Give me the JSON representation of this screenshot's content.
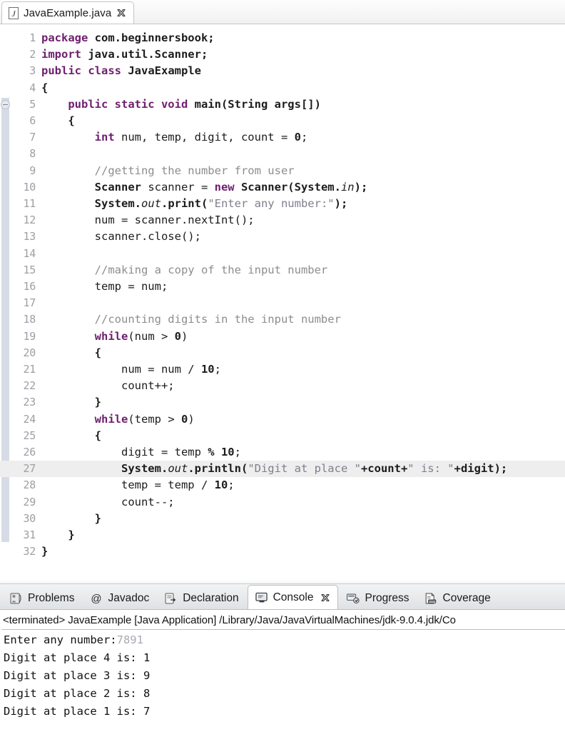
{
  "editor": {
    "tab": {
      "filename": "JavaExample.java",
      "file_icon": "java-file-icon",
      "close_icon": "close-icon"
    },
    "current_line": 27,
    "fold_marker_line": 5,
    "lines": [
      {
        "n": "1",
        "segments": [
          {
            "t": "package ",
            "c": "kw"
          },
          {
            "t": "com.beginnersbook;",
            "c": "bld"
          }
        ]
      },
      {
        "n": "2",
        "segments": [
          {
            "t": "import ",
            "c": "kw"
          },
          {
            "t": "java.util.Scanner;",
            "c": "bld"
          }
        ]
      },
      {
        "n": "3",
        "segments": [
          {
            "t": "public class ",
            "c": "kw"
          },
          {
            "t": "JavaExample",
            "c": "bld"
          }
        ]
      },
      {
        "n": "4",
        "segments": [
          {
            "t": "{",
            "c": "bld"
          }
        ]
      },
      {
        "n": "5",
        "segments": [
          {
            "t": "    ",
            "c": ""
          },
          {
            "t": "public static void ",
            "c": "kw"
          },
          {
            "t": "main(String args[])",
            "c": "bld"
          }
        ]
      },
      {
        "n": "6",
        "segments": [
          {
            "t": "    {",
            "c": "bld"
          }
        ]
      },
      {
        "n": "7",
        "segments": [
          {
            "t": "        ",
            "c": ""
          },
          {
            "t": "int ",
            "c": "kw"
          },
          {
            "t": "num, temp, digit, count = ",
            "c": ""
          },
          {
            "t": "0",
            "c": "num"
          },
          {
            "t": ";",
            "c": ""
          }
        ]
      },
      {
        "n": "8",
        "segments": []
      },
      {
        "n": "9",
        "segments": [
          {
            "t": "        //getting the number from user",
            "c": "cmt"
          }
        ]
      },
      {
        "n": "10",
        "segments": [
          {
            "t": "        ",
            "c": ""
          },
          {
            "t": "Scanner",
            "c": "bld"
          },
          {
            "t": " scanner = ",
            "c": ""
          },
          {
            "t": "new ",
            "c": "kw"
          },
          {
            "t": "Scanner(System.",
            "c": "bld"
          },
          {
            "t": "in",
            "c": "fld"
          },
          {
            "t": ");",
            "c": "bld"
          }
        ]
      },
      {
        "n": "11",
        "segments": [
          {
            "t": "        ",
            "c": ""
          },
          {
            "t": "System.",
            "c": "bld"
          },
          {
            "t": "out",
            "c": "fld"
          },
          {
            "t": ".print(",
            "c": "bld"
          },
          {
            "t": "\"Enter any number:\"",
            "c": "str"
          },
          {
            "t": ");",
            "c": "bld"
          }
        ]
      },
      {
        "n": "12",
        "segments": [
          {
            "t": "        num = scanner.nextInt();",
            "c": ""
          }
        ]
      },
      {
        "n": "13",
        "segments": [
          {
            "t": "        scanner.close();",
            "c": ""
          }
        ]
      },
      {
        "n": "14",
        "segments": []
      },
      {
        "n": "15",
        "segments": [
          {
            "t": "        //making a copy of the input number",
            "c": "cmt"
          }
        ]
      },
      {
        "n": "16",
        "segments": [
          {
            "t": "        temp = num;",
            "c": ""
          }
        ]
      },
      {
        "n": "17",
        "segments": []
      },
      {
        "n": "18",
        "segments": [
          {
            "t": "        //counting digits in the input number",
            "c": "cmt"
          }
        ]
      },
      {
        "n": "19",
        "segments": [
          {
            "t": "        ",
            "c": ""
          },
          {
            "t": "while",
            "c": "kw"
          },
          {
            "t": "(num > ",
            "c": ""
          },
          {
            "t": "0",
            "c": "num"
          },
          {
            "t": ")",
            "c": ""
          }
        ]
      },
      {
        "n": "20",
        "segments": [
          {
            "t": "        {",
            "c": "bld"
          }
        ]
      },
      {
        "n": "21",
        "segments": [
          {
            "t": "            num = num / ",
            "c": ""
          },
          {
            "t": "10",
            "c": "num"
          },
          {
            "t": ";",
            "c": ""
          }
        ]
      },
      {
        "n": "22",
        "segments": [
          {
            "t": "            count++;",
            "c": ""
          }
        ]
      },
      {
        "n": "23",
        "segments": [
          {
            "t": "        }",
            "c": "bld"
          }
        ]
      },
      {
        "n": "24",
        "segments": [
          {
            "t": "        ",
            "c": ""
          },
          {
            "t": "while",
            "c": "kw"
          },
          {
            "t": "(temp > ",
            "c": ""
          },
          {
            "t": "0",
            "c": "num"
          },
          {
            "t": ")",
            "c": ""
          }
        ]
      },
      {
        "n": "25",
        "segments": [
          {
            "t": "        {",
            "c": "bld"
          }
        ]
      },
      {
        "n": "26",
        "segments": [
          {
            "t": "            digit = temp ",
            "c": ""
          },
          {
            "t": "% 10",
            "c": "num"
          },
          {
            "t": ";",
            "c": ""
          }
        ]
      },
      {
        "n": "27",
        "segments": [
          {
            "t": "            ",
            "c": ""
          },
          {
            "t": "System.",
            "c": "bld"
          },
          {
            "t": "out",
            "c": "fld"
          },
          {
            "t": ".println(",
            "c": "bld"
          },
          {
            "t": "\"Digit at place \"",
            "c": "str"
          },
          {
            "t": "+count+",
            "c": "bld"
          },
          {
            "t": "\" is: \"",
            "c": "str"
          },
          {
            "t": "+digit);",
            "c": "bld"
          }
        ]
      },
      {
        "n": "28",
        "segments": [
          {
            "t": "            temp = temp / ",
            "c": ""
          },
          {
            "t": "10",
            "c": "num"
          },
          {
            "t": ";",
            "c": ""
          }
        ]
      },
      {
        "n": "29",
        "segments": [
          {
            "t": "            count--;",
            "c": ""
          }
        ]
      },
      {
        "n": "30",
        "segments": [
          {
            "t": "        }",
            "c": "bld"
          }
        ]
      },
      {
        "n": "31",
        "segments": [
          {
            "t": "    }",
            "c": "bld"
          }
        ]
      },
      {
        "n": "32",
        "segments": [
          {
            "t": "}",
            "c": "bld"
          }
        ]
      }
    ]
  },
  "bottom_panel": {
    "tabs": [
      {
        "label": "Problems",
        "icon": "problems-icon",
        "active": false,
        "closable": false
      },
      {
        "label": "Javadoc",
        "icon": "javadoc-at-icon",
        "active": false,
        "closable": false
      },
      {
        "label": "Declaration",
        "icon": "declaration-icon",
        "active": false,
        "closable": false
      },
      {
        "label": "Console",
        "icon": "console-icon",
        "active": true,
        "closable": true
      },
      {
        "label": "Progress",
        "icon": "progress-icon",
        "active": false,
        "closable": false
      },
      {
        "label": "Coverage",
        "icon": "coverage-icon",
        "active": false,
        "closable": false
      }
    ],
    "console": {
      "launch_line": "<terminated> JavaExample [Java Application] /Library/Java/JavaVirtualMachines/jdk-9.0.4.jdk/Co",
      "prompt_text": "Enter any number:",
      "user_input": "7891",
      "output_lines": [
        "Digit at place 4 is: 1",
        "Digit at place 3 is: 9",
        "Digit at place 2 is: 8",
        "Digit at place 1 is: 7"
      ]
    }
  },
  "colors": {
    "keyword": "#6e1f6e",
    "string": "#7f7f8f",
    "comment": "#8d8d8d",
    "current_line_highlight": "#eeeeee",
    "fold_range": "#d6dce5",
    "user_input": "#a9a9b4"
  }
}
